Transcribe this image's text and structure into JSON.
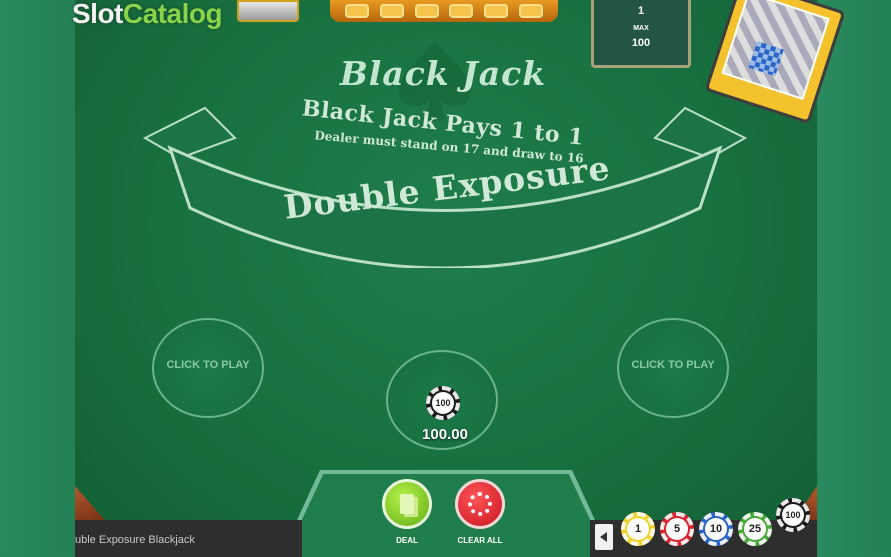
{
  "logo": {
    "part1": "Slot",
    "part2": "Catalog"
  },
  "limits": {
    "min_value": "1",
    "max_label": "MAX",
    "max_value": "100"
  },
  "table": {
    "title": "Black Jack",
    "pays_text": "Black Jack Pays 1 to 1",
    "dealer_rule": "Dealer must stand on 17 and draw to 16",
    "variant": "Double Exposure"
  },
  "spots": {
    "left_label": "CLICK TO PLAY",
    "right_label": "CLICK TO PLAY",
    "center_chip_value": "100",
    "center_bet": "100.00"
  },
  "controls": {
    "deal_label": "DEAL",
    "clear_label": "CLEAR ALL"
  },
  "footer": {
    "game_name": "uble Exposure Blackjack"
  },
  "chips": [
    {
      "value": "1",
      "color": "#f3d12a"
    },
    {
      "value": "5",
      "color": "#d9232d"
    },
    {
      "value": "10",
      "color": "#2a64c7"
    },
    {
      "value": "25",
      "color": "#4aa83a"
    },
    {
      "value": "100",
      "color": "#1b1b1b"
    }
  ]
}
